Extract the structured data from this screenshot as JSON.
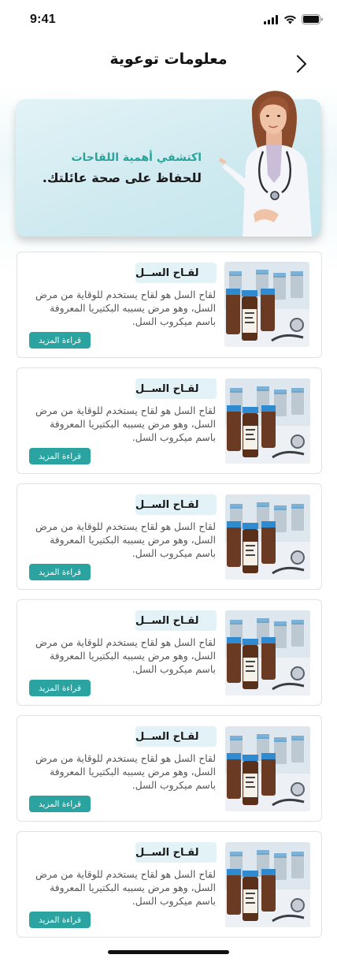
{
  "status_bar": {
    "time": "9:41"
  },
  "header": {
    "title": "معلومات توعوية"
  },
  "hero": {
    "line1": "اكتشفي أهمية اللقاحات",
    "line2": "للحفاظ على صحة عائلتك."
  },
  "cards": [
    {
      "title": "لقـاح الســل",
      "description": "لقاح السل هو لقاح يستخدم للوقاية من مرض السل، وهو مرض يسببه البكتيريا المعروفة باسم ميكروب السل.",
      "button": "قراءة المزيد"
    },
    {
      "title": "لقـاح الســل",
      "description": "لقاح السل هو لقاح يستخدم للوقاية من مرض السل، وهو مرض يسببه البكتيريا المعروفة باسم ميكروب السل.",
      "button": "قراءة المزيد"
    },
    {
      "title": "لقـاح الســل",
      "description": "لقاح السل هو لقاح يستخدم للوقاية من مرض السل، وهو مرض يسببه البكتيريا المعروفة باسم ميكروب السل.",
      "button": "قراءة المزيد"
    },
    {
      "title": "لقـاح الســل",
      "description": "لقاح السل هو لقاح يستخدم للوقاية من مرض السل، وهو مرض يسببه البكتيريا المعروفة باسم ميكروب السل.",
      "button": "قراءة المزيد"
    },
    {
      "title": "لقـاح الســل",
      "description": "لقاح السل هو لقاح يستخدم للوقاية من مرض السل، وهو مرض يسببه البكتيريا المعروفة باسم ميكروب السل.",
      "button": "قراءة المزيد"
    },
    {
      "title": "لقـاح الســل",
      "description": "لقاح السل هو لقاح يستخدم للوقاية من مرض السل، وهو مرض يسببه البكتيريا المعروفة باسم ميكروب السل.",
      "button": "قراءة المزيد"
    }
  ],
  "icons": {
    "back": "chevron-icon",
    "signal": "cellular-signal-icon",
    "wifi": "wifi-icon",
    "battery": "battery-icon"
  },
  "colors": {
    "accent": "#2aa3a1",
    "hero_accent_text": "#2aa39a",
    "pill_bg": "#e3f2f6"
  }
}
